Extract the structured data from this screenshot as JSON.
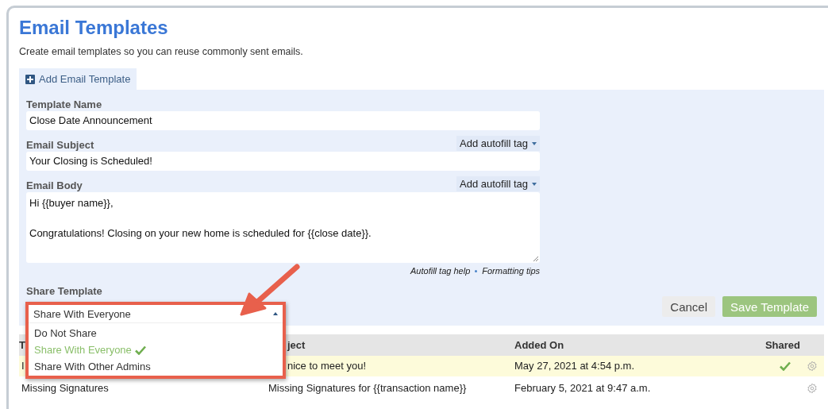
{
  "page": {
    "title": "Email Templates",
    "subtitle": "Create email templates so you can reuse commonly sent emails."
  },
  "tab": {
    "label": "Add Email Template"
  },
  "form": {
    "fields": [
      {
        "kind": "input",
        "label": "Template Name",
        "value": "Close Date Announcement"
      },
      {
        "kind": "input",
        "label": "Email Subject",
        "autofill": "Add autofill tag",
        "value": "Your Closing is Scheduled!"
      },
      {
        "kind": "textarea",
        "label": "Email Body",
        "autofill": "Add autofill tag",
        "value": "Hi {{buyer name}},\n\nCongratulations! Closing on your new home is scheduled for {{close date}}."
      }
    ],
    "help_links": [
      "Autofill tag help",
      "Formatting tips"
    ],
    "share": {
      "label": "Share Template",
      "value": "Share With Everyone",
      "expanded": true,
      "options": [
        {
          "label": "Do Not Share",
          "selected": false
        },
        {
          "label": "Share With Everyone",
          "selected": true
        },
        {
          "label": "Share With Other Admins",
          "selected": false
        }
      ]
    },
    "buttons": [
      {
        "label": "Cancel",
        "kind": "secondary"
      },
      {
        "label": "Save Template",
        "kind": "primary"
      }
    ]
  },
  "table": {
    "columns": [
      "T",
      "ject",
      "Added On",
      "Shared"
    ],
    "rows": [
      {
        "cells": [
          "I",
          "nice to meet you!",
          "May 27, 2021 at 4:54 p.m."
        ],
        "shared": true,
        "highlighted": true
      },
      {
        "cells": [
          "Missing Signatures",
          "Missing Signatures for {{transaction name}}",
          "February 5, 2021 at 9:47 a.m."
        ],
        "shared": false,
        "highlighted": false
      }
    ]
  }
}
